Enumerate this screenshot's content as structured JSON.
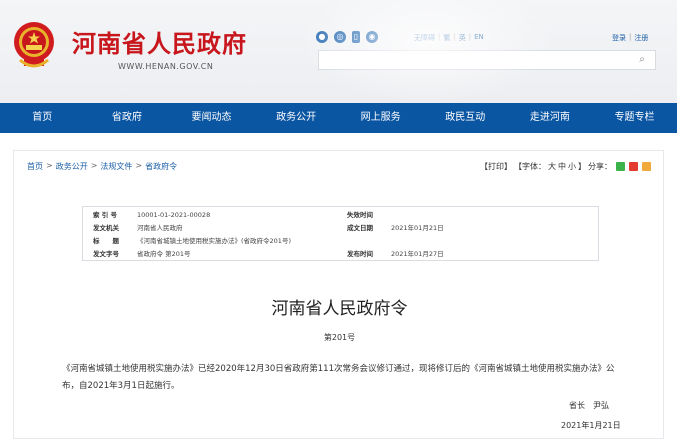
{
  "header": {
    "site_title": "河南省人民政府",
    "site_url": "WWW.HENAN.GOV.CN",
    "lang_links": [
      "无障碍",
      "繁",
      "英",
      "EN"
    ],
    "user_links": [
      "登录",
      "注册"
    ],
    "search_placeholder": ""
  },
  "nav": {
    "items": [
      "首页",
      "省政府",
      "要闻动态",
      "政务公开",
      "网上服务",
      "政民互动",
      "走进河南",
      "专题专栏"
    ]
  },
  "breadcrumb": [
    "首页",
    "政务公开",
    "法规文件",
    "省政府令"
  ],
  "tools": {
    "print": "【打印】",
    "font": "【字体：",
    "large": "大",
    "medium": "中",
    "small": "小",
    "font_end": "】",
    "share": "分享："
  },
  "meta": {
    "index_label": "索 引 号",
    "index_value": "10001-01-2021-00028",
    "expire_label": "失效时间",
    "expire_value": "",
    "issuer_label": "发文机关",
    "issuer_value": "河南省人民政府",
    "date_label": "成文日期",
    "date_value": "2021年01月21日",
    "title_label": "标　　题",
    "title_value": "《河南省城镇土地使用税实施办法》(省政府令201号)",
    "docno_label": "发文字号",
    "docno_value": "省政府令 第201号",
    "publish_label": "发布时间",
    "publish_value": "2021年01月27日"
  },
  "document": {
    "title": "河南省人民政府令",
    "number": "第201号",
    "body": "《河南省城镇土地使用税实施办法》已经2020年12月30日省政府第111次常务会议修订通过，现将修订后的《河南省城镇土地使用税实施办法》公布，自2021年3月1日起施行。",
    "signatory": "省长　尹弘",
    "date": "2021年1月21日"
  }
}
